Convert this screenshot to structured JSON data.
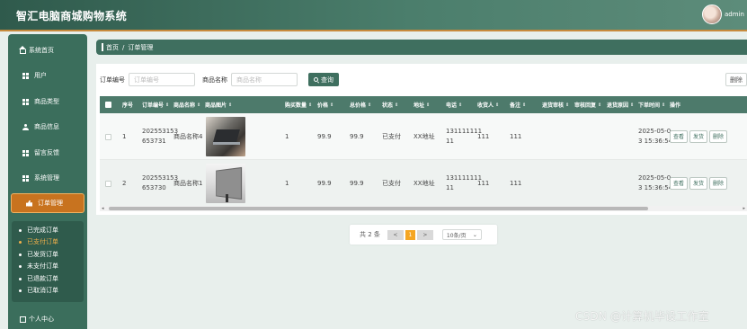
{
  "app": {
    "title": "智汇电脑商城购物系统",
    "user": "admin"
  },
  "sidebar": {
    "items": [
      {
        "label": "系统首页",
        "icon": "home-icon"
      },
      {
        "label": "用户",
        "icon": "grid-icon"
      },
      {
        "label": "商品类型",
        "icon": "grid-icon"
      },
      {
        "label": "商品信息",
        "icon": "person-icon"
      },
      {
        "label": "留言反馈",
        "icon": "grid-icon"
      },
      {
        "label": "系统管理",
        "icon": "grid-icon"
      },
      {
        "label": "订单管理",
        "icon": "thumb-icon",
        "active": true
      }
    ],
    "submenu": [
      "已完成订单",
      "已支付订单",
      "已发货订单",
      "未支付订单",
      "已退款订单",
      "已取消订单"
    ],
    "selected_submenu": "已支付订单",
    "personal": "个人中心"
  },
  "breadcrumb": {
    "home": "首页",
    "separator": "/",
    "current": "订单管理"
  },
  "search": {
    "order_label": "订单编号",
    "order_placeholder": "订单编号",
    "product_label": "商品名称",
    "product_placeholder": "商品名称",
    "button": "查询",
    "delete_button": "删除"
  },
  "table": {
    "headers": [
      "序号",
      "订单编号",
      "商品名称",
      "商品图片",
      "购买数量",
      "价格",
      "总价格",
      "状态",
      "地址",
      "电话",
      "收货人",
      "备注",
      "退货审核",
      "审核回复",
      "退货原因",
      "下单时间",
      "操作"
    ],
    "rows": [
      {
        "index": "1",
        "order_no_a": "202553153",
        "order_no_b": "653731",
        "product": "商品名称4",
        "qty": "1",
        "price": "99.9",
        "total": "99.9",
        "status": "已支付",
        "address": "XX地址",
        "phone_a": "131111111",
        "phone_b": "11",
        "receiver": "111",
        "remark": "111",
        "time_a": "2025-05-0",
        "time_b": "3 15:36:54"
      },
      {
        "index": "2",
        "order_no_a": "202553153",
        "order_no_b": "653730",
        "product": "商品名称1",
        "qty": "1",
        "price": "99.9",
        "total": "99.9",
        "status": "已支付",
        "address": "XX地址",
        "phone_a": "131111111",
        "phone_b": "11",
        "receiver": "111",
        "remark": "111",
        "time_a": "2025-05-0",
        "time_b": "3 15:36:54"
      }
    ],
    "actions": {
      "view": "查看",
      "ship": "发货",
      "delete": "删除"
    }
  },
  "pagination": {
    "total": "共 2 条",
    "prev": "<",
    "current_page": "1",
    "next": ">",
    "page_size": "10条/页"
  },
  "watermark": "CSDN @计算机毕设工作室",
  "colors": {
    "header": "#3f6f5f",
    "active": "#c8731f",
    "selected_sub": "#f2b04a",
    "current_page": "#f5a623"
  }
}
